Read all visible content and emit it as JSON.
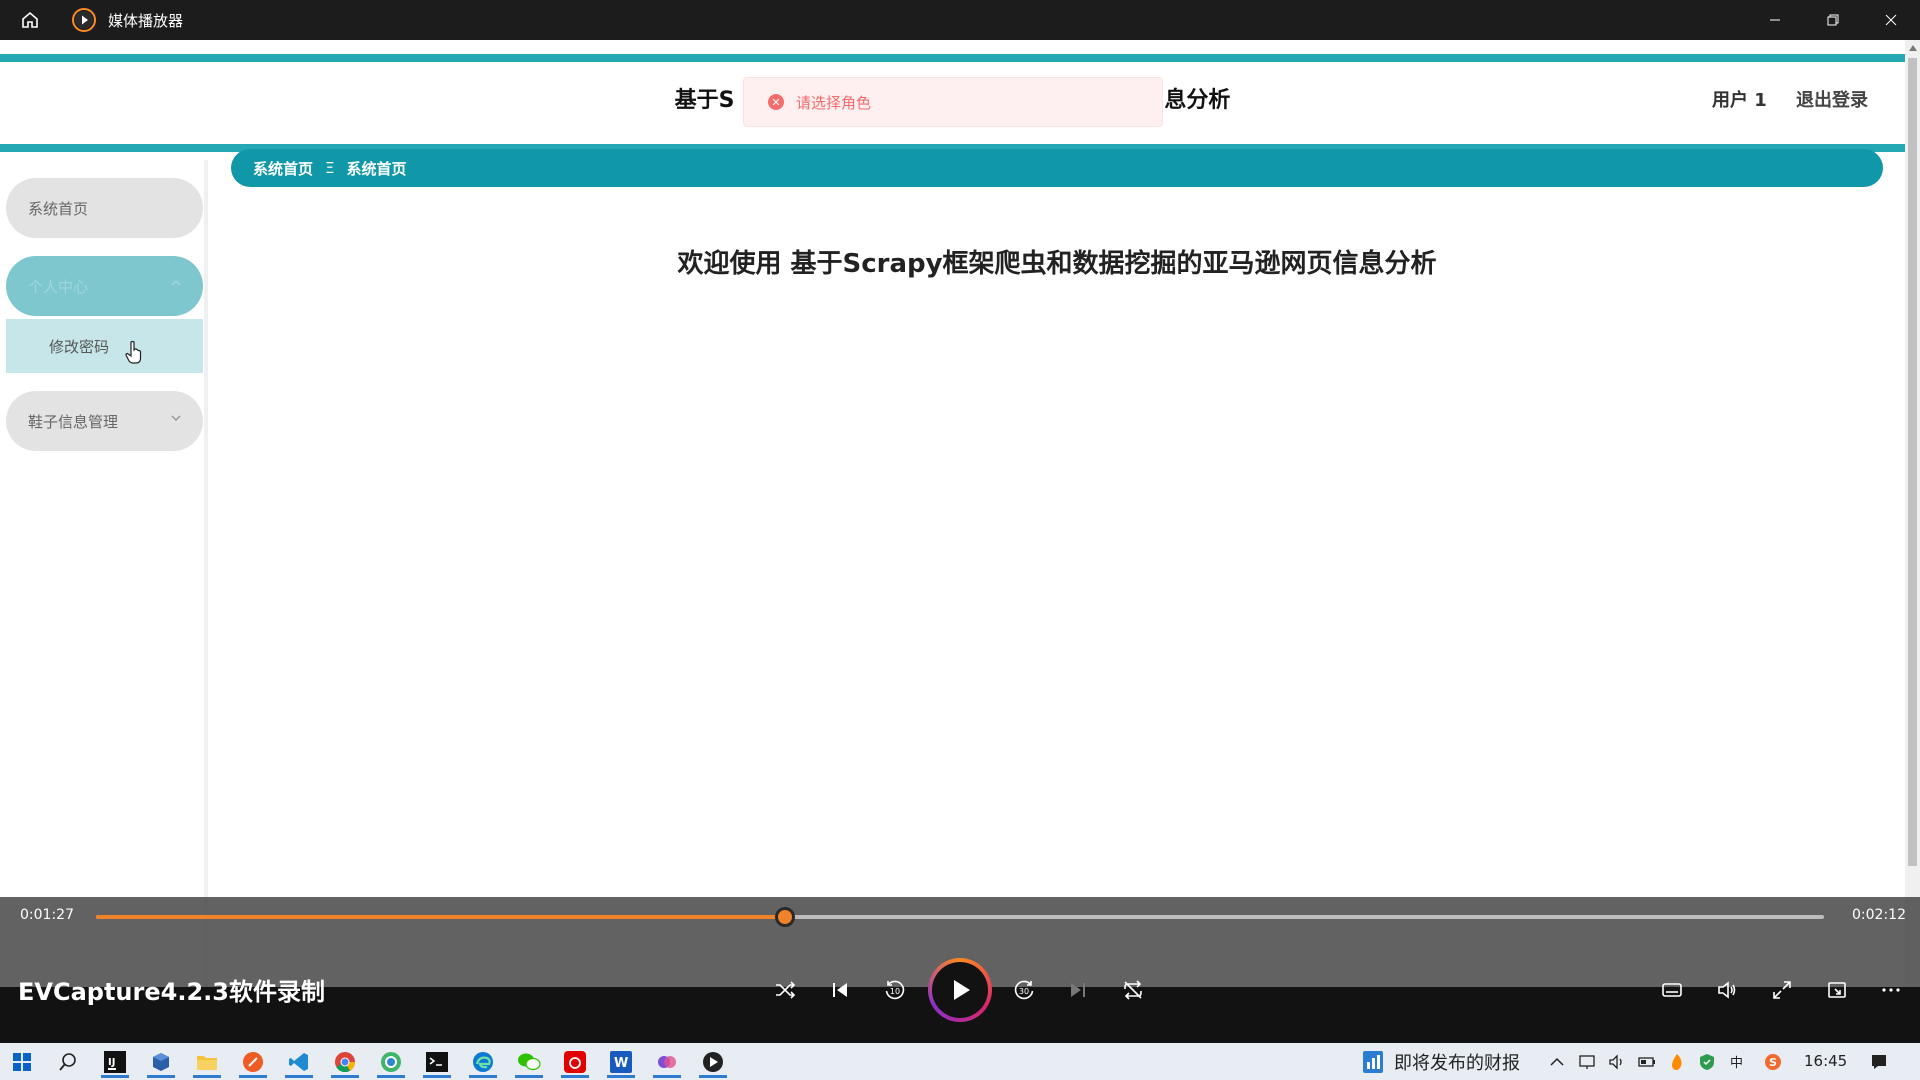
{
  "titlebar": {
    "title": "媒体播放器",
    "icons": [
      "home-icon",
      "media-player-icon",
      "minimize-icon",
      "restore-icon",
      "close-icon"
    ]
  },
  "site": {
    "title_prefix": "基于S",
    "title_suffix": "息分析",
    "user_label": "用户 1",
    "logout_label": "退出登录",
    "accent_color": "#23a8b4"
  },
  "toast": {
    "message": "请选择角色",
    "icon": "error-circle-icon",
    "color": "#f56c6c"
  },
  "sidebar": {
    "items": [
      {
        "label": "系统首页"
      },
      {
        "label": "个人中心",
        "expanded": true
      },
      {
        "label": "修改密码",
        "sub": true
      },
      {
        "label": "鞋子信息管理"
      }
    ]
  },
  "breadcrumb": {
    "home": "系统首页",
    "separator": "Ξ",
    "current": "系统首页"
  },
  "welcome": {
    "text": "欢迎使用 基于Scrapy框架爬虫和数据挖掘的亚马逊网页信息分析"
  },
  "player": {
    "current_time": "0:01:27",
    "duration": "0:02:12",
    "progress": 0.399,
    "caption": "EVCapture4.2.3软件录制",
    "progress_color": "#f0822a",
    "controls": [
      "shuffle-icon",
      "previous-icon",
      "rewind-10-icon",
      "play-icon",
      "forward-30-icon",
      "next-icon",
      "repeat-icon",
      "subtitles-icon",
      "volume-icon",
      "fullscreen-icon",
      "miniplayer-icon",
      "more-icon"
    ]
  },
  "taskbar": {
    "news_text": "即将发布的财报",
    "clock": "16:45",
    "apps": [
      "start-icon",
      "search-icon",
      "intellij-icon",
      "virtualbox-icon",
      "file-explorer-icon",
      "postman-icon",
      "vscode-icon",
      "chrome-icon",
      "browser-icon",
      "terminal-icon",
      "edge-icon",
      "wechat-icon",
      "netease-music-icon",
      "word-icon",
      "app-icon",
      "media-player-icon"
    ]
  }
}
